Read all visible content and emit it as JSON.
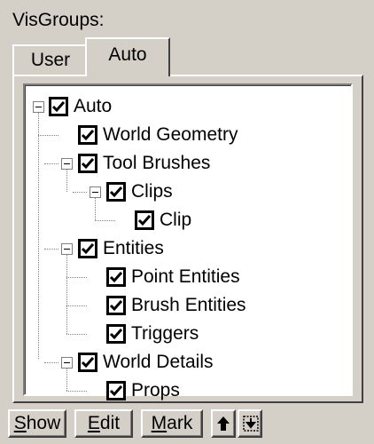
{
  "panel": {
    "title": "VisGroups:"
  },
  "tabs": [
    {
      "label": "User",
      "selected": false
    },
    {
      "label": "Auto",
      "selected": true
    }
  ],
  "tree": {
    "items": [
      {
        "label": "Auto",
        "checked": true,
        "expanded": true,
        "level": 0
      },
      {
        "label": "World Geometry",
        "checked": true,
        "level": 1
      },
      {
        "label": "Tool Brushes",
        "checked": true,
        "expanded": true,
        "level": 1
      },
      {
        "label": "Clips",
        "checked": true,
        "expanded": true,
        "level": 2
      },
      {
        "label": "Clip",
        "checked": true,
        "level": 3
      },
      {
        "label": "Entities",
        "checked": true,
        "expanded": true,
        "level": 1
      },
      {
        "label": "Point Entities",
        "checked": true,
        "level": 2
      },
      {
        "label": "Brush Entities",
        "checked": true,
        "level": 2
      },
      {
        "label": "Triggers",
        "checked": true,
        "level": 2
      },
      {
        "label": "World Details",
        "checked": true,
        "expanded": true,
        "level": 1
      },
      {
        "label": "Props",
        "checked": true,
        "level": 2
      }
    ]
  },
  "buttons": {
    "show": {
      "mnemonic": "S",
      "rest": "how"
    },
    "edit": {
      "mnemonic": "E",
      "rest": "dit"
    },
    "mark": {
      "mnemonic": "M",
      "rest": "ark"
    },
    "move_up_icon": "arrow-up-icon",
    "move_down_icon": "arrow-down-into-icon"
  }
}
